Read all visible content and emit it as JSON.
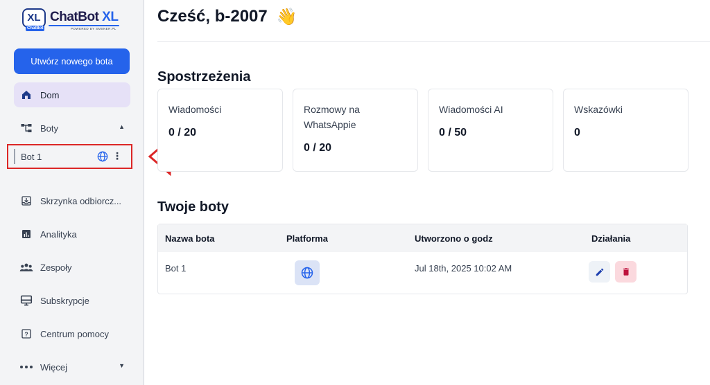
{
  "brand": {
    "badge": "XL",
    "badge_sub": "ChatBot",
    "name_main": "ChatBot",
    "name_accent": "XL",
    "powered": "POWERED BY SMSNER.PL"
  },
  "sidebar": {
    "create_button": "Utwórz nowego bota",
    "items": [
      {
        "label": "Dom",
        "icon": "home-icon"
      },
      {
        "label": "Boty",
        "icon": "bots-icon"
      },
      {
        "label": "Skrzynka odbiorcz...",
        "icon": "inbox-icon"
      },
      {
        "label": "Analityka",
        "icon": "analytics-icon"
      },
      {
        "label": "Zespoły",
        "icon": "teams-icon"
      },
      {
        "label": "Subskrypcje",
        "icon": "subscriptions-icon"
      },
      {
        "label": "Centrum pomocy",
        "icon": "help-icon"
      },
      {
        "label": "Więcej",
        "icon": "more-icon"
      }
    ],
    "bot_entry": {
      "label": "Bot 1",
      "icon": "globe-icon"
    }
  },
  "header": {
    "greeting": "Cześć, b-2007",
    "emoji": "👋"
  },
  "insights": {
    "title": "Spostrzeżenia",
    "cards": [
      {
        "label": "Wiadomości",
        "value": "0 / 20"
      },
      {
        "label": "Rozmowy na WhatsAppie",
        "value": "0 / 20"
      },
      {
        "label": "Wiadomości AI",
        "value": "0 / 50"
      },
      {
        "label": "Wskazówki",
        "value": "0"
      }
    ]
  },
  "bots_table": {
    "title": "Twoje boty",
    "columns": [
      "Nazwa bota",
      "Platforma",
      "Utworzono o godz",
      "Działania"
    ],
    "rows": [
      {
        "name": "Bot 1",
        "platform": "globe-icon",
        "created": "Jul 18th, 2025 10:02 AM"
      }
    ]
  },
  "colors": {
    "primary": "#2563eb",
    "annotation": "#dc2626",
    "active_nav": "#e6e1f7",
    "delete": "#be123c"
  }
}
